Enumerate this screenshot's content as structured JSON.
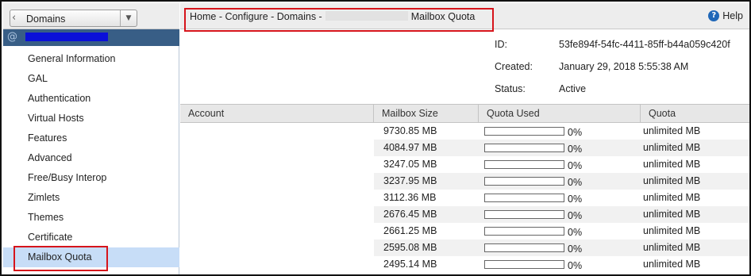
{
  "nav_header": {
    "back_label": "Domains"
  },
  "domain": {
    "icon": "at-icon",
    "name_redacted": true
  },
  "sidebar": {
    "items": [
      {
        "label": "General Information",
        "active": false
      },
      {
        "label": "GAL",
        "active": false
      },
      {
        "label": "Authentication",
        "active": false
      },
      {
        "label": "Virtual Hosts",
        "active": false
      },
      {
        "label": "Features",
        "active": false
      },
      {
        "label": "Advanced",
        "active": false
      },
      {
        "label": "Free/Busy Interop",
        "active": false
      },
      {
        "label": "Zimlets",
        "active": false
      },
      {
        "label": "Themes",
        "active": false
      },
      {
        "label": "Certificate",
        "active": false
      },
      {
        "label": "Mailbox Quota",
        "active": true
      }
    ]
  },
  "breadcrumb": {
    "prefix": "Home - Configure - Domains -",
    "suffix": "Mailbox Quota"
  },
  "help": {
    "label": "Help",
    "icon": "help-icon"
  },
  "info": {
    "id_label": "ID:",
    "id_value": "53fe894f-54fc-4411-85ff-b44a059c420f",
    "created_label": "Created:",
    "created_value": "January 29, 2018 5:55:38 AM",
    "status_label": "Status:",
    "status_value": "Active"
  },
  "table": {
    "headers": {
      "account": "Account",
      "mailbox_size": "Mailbox Size",
      "quota_used": "Quota Used",
      "quota": "Quota"
    },
    "rows": [
      {
        "size": "9730.85 MB",
        "used": "0%",
        "used_fraction": 0,
        "quota": "unlimited MB"
      },
      {
        "size": "4084.97 MB",
        "used": "0%",
        "used_fraction": 0,
        "quota": "unlimited MB"
      },
      {
        "size": "3247.05 MB",
        "used": "0%",
        "used_fraction": 0,
        "quota": "unlimited MB"
      },
      {
        "size": "3237.95 MB",
        "used": "0%",
        "used_fraction": 0,
        "quota": "unlimited MB"
      },
      {
        "size": "3112.36 MB",
        "used": "0%",
        "used_fraction": 0,
        "quota": "unlimited MB"
      },
      {
        "size": "2676.45 MB",
        "used": "0%",
        "used_fraction": 0,
        "quota": "unlimited MB"
      },
      {
        "size": "2661.25 MB",
        "used": "0%",
        "used_fraction": 0,
        "quota": "unlimited MB"
      },
      {
        "size": "2595.08 MB",
        "used": "0%",
        "used_fraction": 0,
        "quota": "unlimited MB"
      },
      {
        "size": "2495.14 MB",
        "used": "0%",
        "used_fraction": 0,
        "quota": "unlimited MB"
      }
    ]
  },
  "colors": {
    "domain_bar": "#385e86",
    "selected_nav": "#c7ddf7",
    "highlight_box": "#d6141b",
    "redaction_blue": "#0a10d9"
  }
}
